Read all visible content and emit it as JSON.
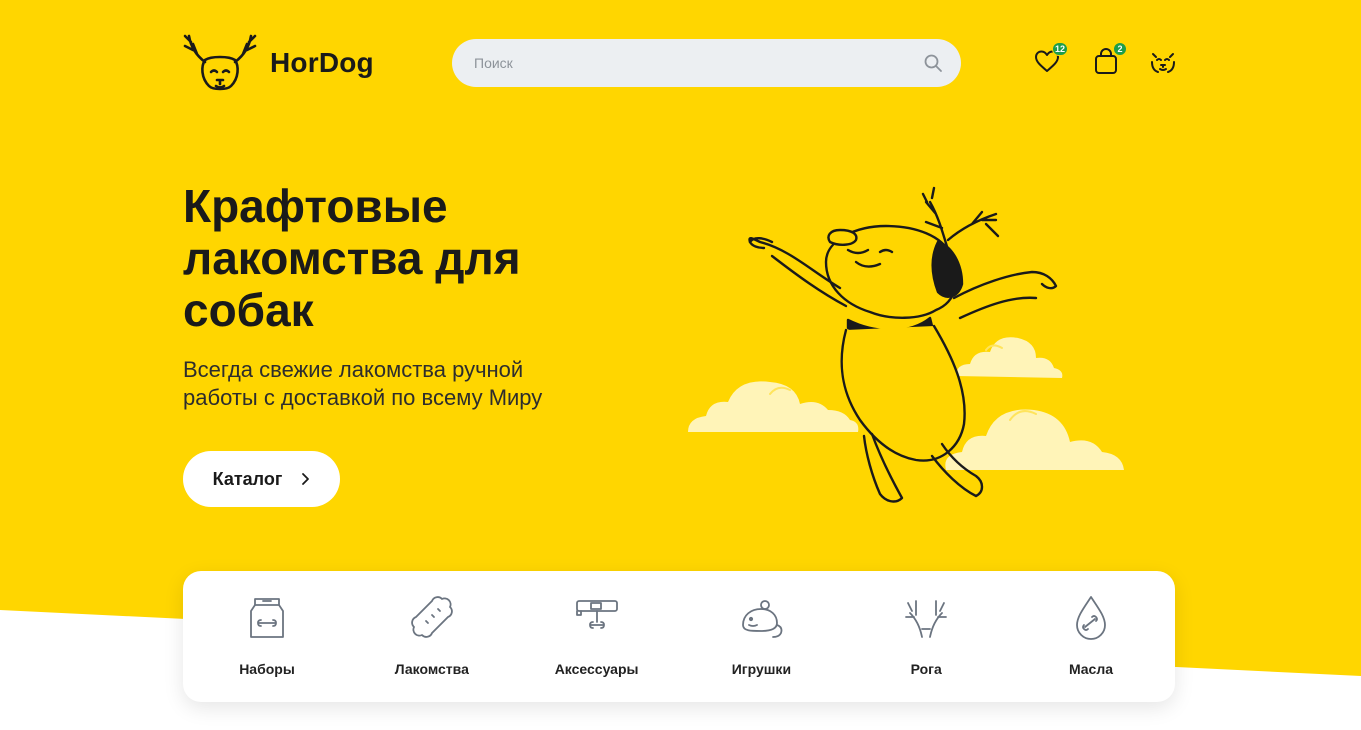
{
  "brand": {
    "name": "HorDog"
  },
  "search": {
    "placeholder": "Поиск"
  },
  "header": {
    "favorites_count": "12",
    "cart_count": "2"
  },
  "hero": {
    "title": "Крафтовые лакомства для собак",
    "subtitle": "Всегда свежие лакомства ручной работы с доставкой по всему Миру",
    "cta_label": "Каталог"
  },
  "categories": [
    {
      "label": "Наборы",
      "icon": "bag-icon"
    },
    {
      "label": "Лакомства",
      "icon": "bone-icon"
    },
    {
      "label": "Аксессуары",
      "icon": "accessory-icon"
    },
    {
      "label": "Игрушки",
      "icon": "mouse-toy-icon"
    },
    {
      "label": "Рога",
      "icon": "antlers-icon"
    },
    {
      "label": "Масла",
      "icon": "oil-drop-icon"
    }
  ],
  "colors": {
    "brand_yellow": "#ffd600",
    "badge_green": "#1e9d4a",
    "cloud": "#fff4b8"
  }
}
